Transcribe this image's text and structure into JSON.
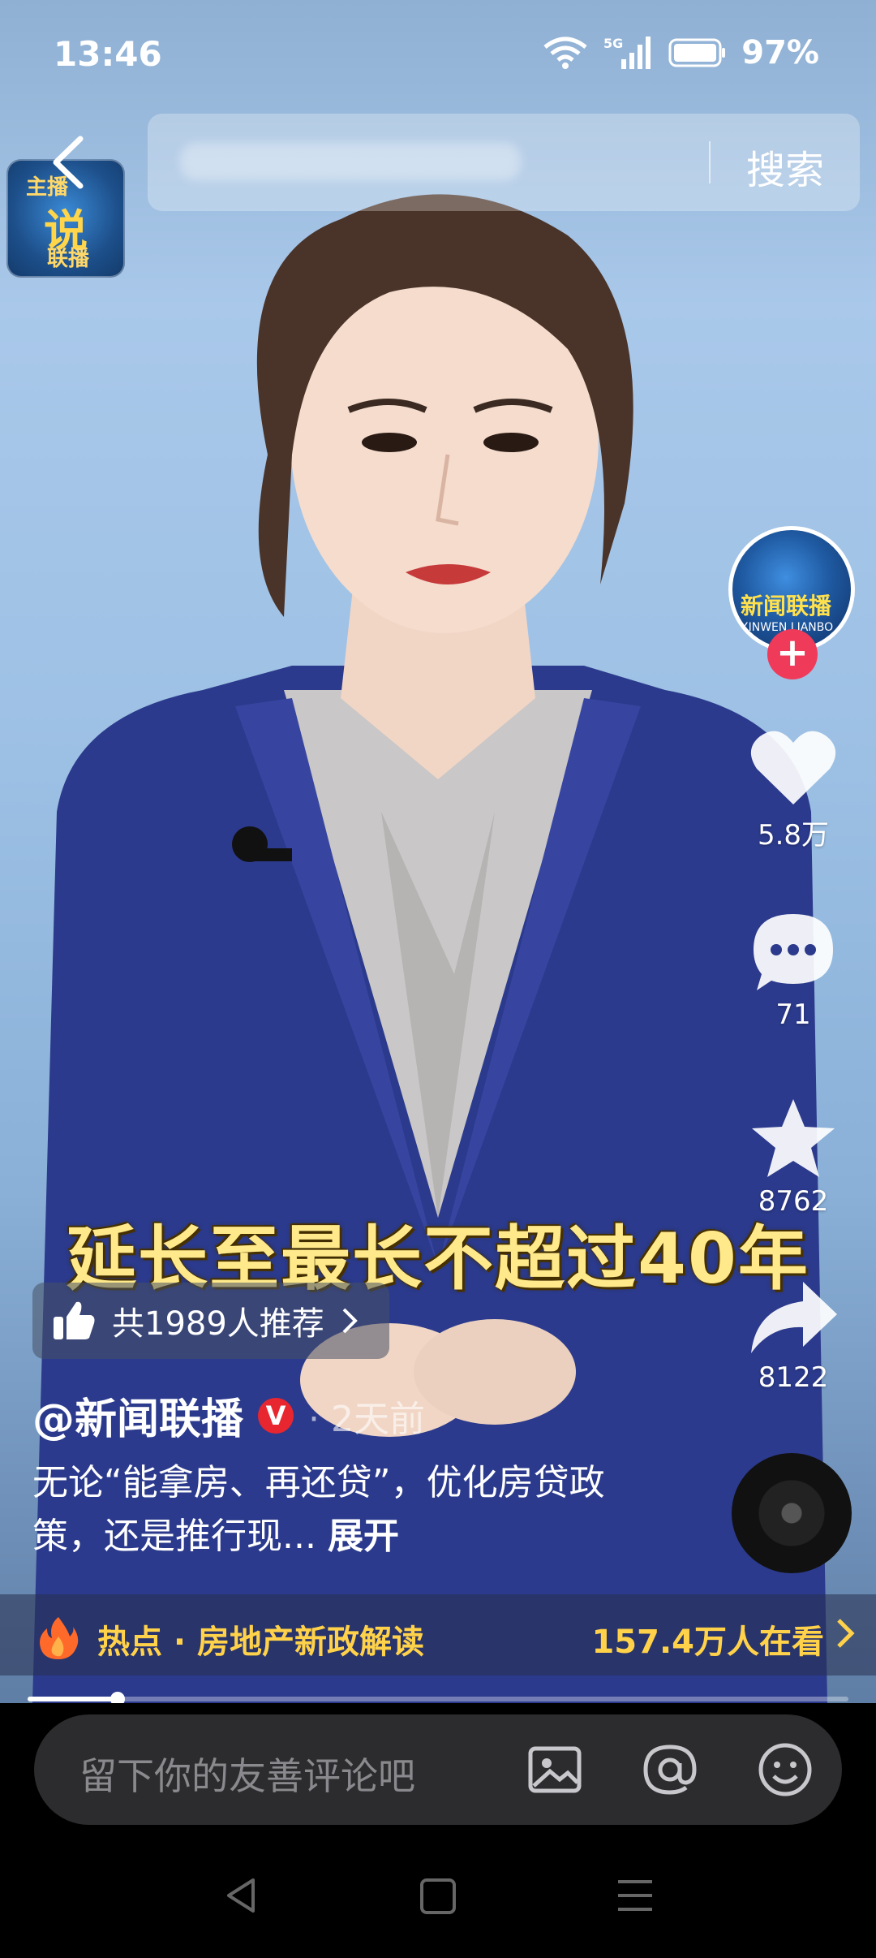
{
  "status_bar": {
    "time": "13:46",
    "network": "5G",
    "battery": "97%"
  },
  "search": {
    "button_label": "搜索"
  },
  "channel_logo": {
    "line1": "主播",
    "line2": "说",
    "line3": "联播"
  },
  "avatar": {
    "title": "新闻联播",
    "subtitle": "XINWEN LIANBO"
  },
  "actions": {
    "likes": "5.8万",
    "comments": "71",
    "favorites": "8762",
    "shares": "8122"
  },
  "video": {
    "caption": "延长至最长不超过40年",
    "recommend_label": "共1989人推荐",
    "author": "@新闻联播",
    "verified_badge": "V",
    "posted": "· 2天前",
    "description": "无论“能拿房、再还贷”，优化房贷政策，还是推行现...",
    "expand_label": "展开",
    "progress": 0.11
  },
  "hot_topic": {
    "label": "热点 · 房地产新政解读",
    "viewers": "157.4万人在看"
  },
  "comment_bar": {
    "placeholder": "留下你的友善评论吧"
  },
  "colors": {
    "accent_gold": "#ffd24a",
    "follow_red": "#f03a5a",
    "verified_red": "#e8262f"
  }
}
